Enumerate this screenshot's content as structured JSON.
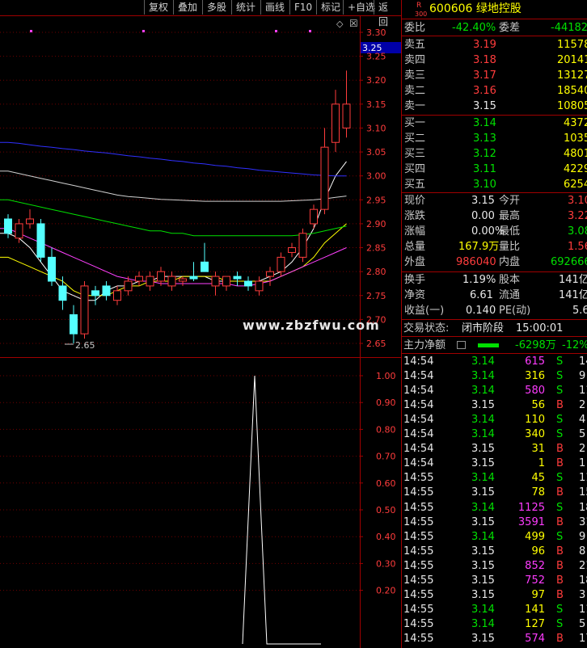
{
  "toolbar": {
    "buttons": [
      "复权",
      "叠加",
      "多股",
      "统计",
      "画线",
      "F10",
      "标记",
      "+自选",
      "返回"
    ]
  },
  "price_axis": {
    "labels": [
      "3.30",
      "3.25",
      "3.20",
      "3.15",
      "3.10",
      "3.05",
      "3.00",
      "2.95",
      "2.90",
      "2.85",
      "2.80",
      "2.75",
      "2.70",
      "2.65"
    ],
    "current_tag": "3.25",
    "low_marker": "2.65"
  },
  "indicator_axis": {
    "labels": [
      "1.00",
      "0.90",
      "0.80",
      "0.70",
      "0.60",
      "0.50",
      "0.40",
      "0.30",
      "0.20"
    ]
  },
  "watermark": "www.zbzfwu.com",
  "stock": {
    "badge_top": "R",
    "badge_bottom": "300",
    "code_name": "600606 绿地控股"
  },
  "ratio": {
    "label": "委比",
    "value": "-42.40%",
    "diff_label": "委差",
    "diff_value": "-44182"
  },
  "asks": [
    {
      "label": "卖五",
      "price": "3.19",
      "vol": "11578"
    },
    {
      "label": "卖四",
      "price": "3.18",
      "vol": "20141"
    },
    {
      "label": "卖三",
      "price": "3.17",
      "vol": "13127"
    },
    {
      "label": "卖二",
      "price": "3.16",
      "vol": "18540"
    },
    {
      "label": "卖一",
      "price": "3.15",
      "vol": "10805"
    }
  ],
  "bids": [
    {
      "label": "买一",
      "price": "3.14",
      "vol": "4372"
    },
    {
      "label": "买二",
      "price": "3.13",
      "vol": "10353"
    },
    {
      "label": "买三",
      "price": "3.12",
      "vol": "4801"
    },
    {
      "label": "买四",
      "price": "3.11",
      "vol": "4229"
    },
    {
      "label": "买五",
      "price": "3.10",
      "vol": "6254"
    }
  ],
  "quote": [
    {
      "l1": "现价",
      "v1": "3.15",
      "l2": "今开",
      "v2": "3.10"
    },
    {
      "l1": "涨跌",
      "v1": "0.00",
      "l2": "最高",
      "v2": "3.22"
    },
    {
      "l1": "涨幅",
      "v1": "0.00%",
      "l2": "最低",
      "v2": "3.08"
    },
    {
      "l1": "总量",
      "v1": "167.9万",
      "l2": "量比",
      "v2": "1.56"
    },
    {
      "l1": "外盘",
      "v1": "986040",
      "l2": "内盘",
      "v2": "692666"
    }
  ],
  "stats": [
    {
      "l1": "换手",
      "v1": "1.19%",
      "l2": "股本",
      "v2": "141亿"
    },
    {
      "l1": "净资",
      "v1": "6.61",
      "l2": "流通",
      "v2": "141亿"
    },
    {
      "l1": "收益(一)",
      "v1": "0.140",
      "l2": "PE(动)",
      "v2": "5.6"
    }
  ],
  "status": {
    "label": "交易状态:",
    "value": "闭市阶段",
    "time": "15:00:01"
  },
  "fund_flow": {
    "label": "主力净额",
    "value": "-6298万",
    "pct": "-12%"
  },
  "ticks": [
    {
      "t": "14:54",
      "p": "3.14",
      "v": "615",
      "s": "S",
      "n": "14"
    },
    {
      "t": "14:54",
      "p": "3.14",
      "v": "316",
      "s": "S",
      "n": "9"
    },
    {
      "t": "14:54",
      "p": "3.14",
      "v": "580",
      "s": "S",
      "n": "11"
    },
    {
      "t": "14:54",
      "p": "3.15",
      "v": "56",
      "s": "B",
      "n": "2"
    },
    {
      "t": "14:54",
      "p": "3.14",
      "v": "110",
      "s": "S",
      "n": "4"
    },
    {
      "t": "14:54",
      "p": "3.14",
      "v": "340",
      "s": "S",
      "n": "5"
    },
    {
      "t": "14:54",
      "p": "3.15",
      "v": "31",
      "s": "B",
      "n": "2"
    },
    {
      "t": "14:54",
      "p": "3.15",
      "v": "1",
      "s": "B",
      "n": "1"
    },
    {
      "t": "14:55",
      "p": "3.14",
      "v": "45",
      "s": "S",
      "n": "11"
    },
    {
      "t": "14:55",
      "p": "3.15",
      "v": "78",
      "s": "B",
      "n": "15"
    },
    {
      "t": "14:55",
      "p": "3.14",
      "v": "1125",
      "s": "S",
      "n": "18"
    },
    {
      "t": "14:55",
      "p": "3.15",
      "v": "3591",
      "s": "B",
      "n": "31"
    },
    {
      "t": "14:55",
      "p": "3.14",
      "v": "499",
      "s": "S",
      "n": "9"
    },
    {
      "t": "14:55",
      "p": "3.15",
      "v": "96",
      "s": "B",
      "n": "8"
    },
    {
      "t": "14:55",
      "p": "3.15",
      "v": "852",
      "s": "B",
      "n": "21"
    },
    {
      "t": "14:55",
      "p": "3.15",
      "v": "752",
      "s": "B",
      "n": "18"
    },
    {
      "t": "14:55",
      "p": "3.15",
      "v": "97",
      "s": "B",
      "n": "3"
    },
    {
      "t": "14:55",
      "p": "3.14",
      "v": "141",
      "s": "S",
      "n": "11"
    },
    {
      "t": "14:55",
      "p": "3.14",
      "v": "127",
      "s": "S",
      "n": "5"
    },
    {
      "t": "14:55",
      "p": "3.15",
      "v": "574",
      "s": "B",
      "n": "17"
    }
  ],
  "chart_data": [
    {
      "type": "candlestick",
      "ylim": [
        2.62,
        3.32
      ],
      "candles": [
        {
          "o": 2.91,
          "h": 2.92,
          "l": 2.87,
          "c": 2.88
        },
        {
          "o": 2.87,
          "h": 2.91,
          "l": 2.86,
          "c": 2.9
        },
        {
          "o": 2.9,
          "h": 2.93,
          "l": 2.89,
          "c": 2.91
        },
        {
          "o": 2.9,
          "h": 2.91,
          "l": 2.82,
          "c": 2.83
        },
        {
          "o": 2.83,
          "h": 2.85,
          "l": 2.77,
          "c": 2.78
        },
        {
          "o": 2.77,
          "h": 2.79,
          "l": 2.72,
          "c": 2.74
        },
        {
          "o": 2.71,
          "h": 2.73,
          "l": 2.65,
          "c": 2.67
        },
        {
          "o": 2.67,
          "h": 2.78,
          "l": 2.66,
          "c": 2.77
        },
        {
          "o": 2.76,
          "h": 2.77,
          "l": 2.73,
          "c": 2.75
        },
        {
          "o": 2.77,
          "h": 2.78,
          "l": 2.74,
          "c": 2.75
        },
        {
          "o": 2.74,
          "h": 2.77,
          "l": 2.73,
          "c": 2.76
        },
        {
          "o": 2.76,
          "h": 2.79,
          "l": 2.75,
          "c": 2.78
        },
        {
          "o": 2.78,
          "h": 2.8,
          "l": 2.77,
          "c": 2.79
        },
        {
          "o": 2.77,
          "h": 2.8,
          "l": 2.76,
          "c": 2.79
        },
        {
          "o": 2.78,
          "h": 2.81,
          "l": 2.77,
          "c": 2.8
        },
        {
          "o": 2.77,
          "h": 2.8,
          "l": 2.76,
          "c": 2.79
        },
        {
          "o": 2.78,
          "h": 2.79,
          "l": 2.77,
          "c": 2.785
        },
        {
          "o": 2.79,
          "h": 2.82,
          "l": 2.78,
          "c": 2.785
        },
        {
          "o": 2.82,
          "h": 2.86,
          "l": 2.8,
          "c": 2.8
        },
        {
          "o": 2.77,
          "h": 2.8,
          "l": 2.75,
          "c": 2.79
        },
        {
          "o": 2.77,
          "h": 2.79,
          "l": 2.76,
          "c": 2.79
        },
        {
          "o": 2.79,
          "h": 2.8,
          "l": 2.77,
          "c": 2.785
        },
        {
          "o": 2.78,
          "h": 2.79,
          "l": 2.76,
          "c": 2.77
        },
        {
          "o": 2.76,
          "h": 2.79,
          "l": 2.75,
          "c": 2.78
        },
        {
          "o": 2.79,
          "h": 2.81,
          "l": 2.77,
          "c": 2.8
        },
        {
          "o": 2.8,
          "h": 2.84,
          "l": 2.79,
          "c": 2.83
        },
        {
          "o": 2.84,
          "h": 2.86,
          "l": 2.83,
          "c": 2.85
        },
        {
          "o": 2.83,
          "h": 2.89,
          "l": 2.82,
          "c": 2.88
        },
        {
          "o": 2.9,
          "h": 2.94,
          "l": 2.89,
          "c": 2.93
        },
        {
          "o": 2.93,
          "h": 3.1,
          "l": 2.92,
          "c": 3.06
        },
        {
          "o": 3.07,
          "h": 3.18,
          "l": 3.05,
          "c": 3.15
        },
        {
          "o": 3.1,
          "h": 3.22,
          "l": 3.08,
          "c": 3.15
        }
      ],
      "ma": [
        {
          "color": "#ffffff",
          "values": [
            2.88,
            2.87,
            2.85,
            2.82,
            2.79,
            2.76,
            2.75,
            2.74,
            2.74,
            2.76,
            2.77,
            2.77,
            2.78,
            2.78,
            2.79,
            2.79,
            2.79,
            2.79,
            2.79,
            2.78,
            2.78,
            2.78,
            2.78,
            2.78,
            2.79,
            2.8,
            2.82,
            2.85,
            2.89,
            2.95,
            3.0,
            3.03
          ]
        },
        {
          "color": "#ffff00",
          "values": [
            2.83,
            2.82,
            2.81,
            2.8,
            2.79,
            2.78,
            2.76,
            2.75,
            2.75,
            2.75,
            2.76,
            2.77,
            2.77,
            2.78,
            2.78,
            2.78,
            2.79,
            2.79,
            2.79,
            2.79,
            2.78,
            2.78,
            2.78,
            2.78,
            2.78,
            2.79,
            2.8,
            2.81,
            2.83,
            2.86,
            2.88,
            2.9
          ]
        },
        {
          "color": "#ff40ff",
          "values": [
            2.89,
            2.88,
            2.87,
            2.86,
            2.85,
            2.84,
            2.83,
            2.82,
            2.81,
            2.8,
            2.79,
            2.785,
            2.78,
            2.78,
            2.775,
            2.775,
            2.775,
            2.775,
            2.775,
            2.775,
            2.775,
            2.77,
            2.77,
            2.775,
            2.78,
            2.79,
            2.8,
            2.81,
            2.82,
            2.83,
            2.84,
            2.85
          ]
        },
        {
          "color": "#00e000",
          "values": [
            2.95,
            2.945,
            2.94,
            2.935,
            2.93,
            2.925,
            2.92,
            2.915,
            2.91,
            2.905,
            2.9,
            2.895,
            2.89,
            2.885,
            2.885,
            2.88,
            2.88,
            2.875,
            2.875,
            2.875,
            2.875,
            2.875,
            2.875,
            2.875,
            2.875,
            2.875,
            2.875,
            2.877,
            2.88,
            2.885,
            2.89,
            2.895
          ]
        },
        {
          "color": "#d0d0d0",
          "values": [
            3.01,
            3.005,
            3.0,
            2.995,
            2.99,
            2.985,
            2.98,
            2.975,
            2.97,
            2.965,
            2.96,
            2.957,
            2.955,
            2.953,
            2.951,
            2.95,
            2.949,
            2.948,
            2.947,
            2.947,
            2.947,
            2.947,
            2.947,
            2.947,
            2.947,
            2.947,
            2.948,
            2.949,
            2.95,
            2.952,
            2.955,
            2.958
          ]
        },
        {
          "color": "#3030ff",
          "values": [
            3.07,
            3.068,
            3.065,
            3.062,
            3.06,
            3.057,
            3.055,
            3.052,
            3.05,
            3.048,
            3.045,
            3.042,
            3.04,
            3.037,
            3.035,
            3.032,
            3.03,
            3.027,
            3.025,
            3.022,
            3.02,
            3.017,
            3.015,
            3.012,
            3.01,
            3.008,
            3.006,
            3.004,
            3.002,
            3.001,
            3.0,
            3.0
          ]
        }
      ]
    },
    {
      "type": "line",
      "ylim": [
        0.0,
        1.05
      ],
      "x": [
        0,
        1,
        2,
        3
      ],
      "values": [
        0.0,
        1.0,
        0.0,
        0.0
      ]
    }
  ]
}
